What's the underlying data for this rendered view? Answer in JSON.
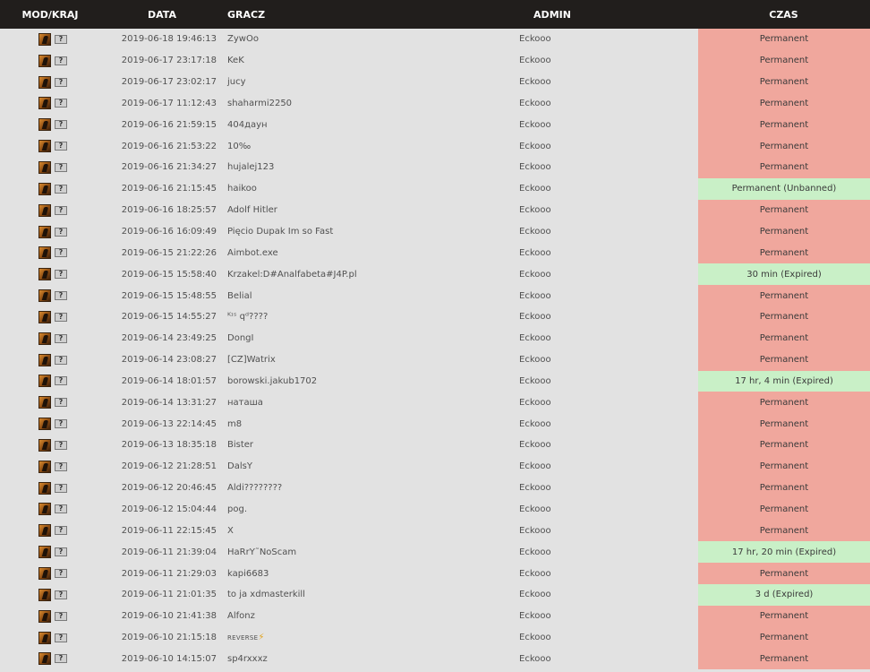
{
  "header": {
    "mod": "MOD/KRAJ",
    "date": "DATA",
    "player": "GRACZ",
    "admin": "ADMIN",
    "time": "CZAS"
  },
  "colors": {
    "permanent": "#f0a79d",
    "unbanned_or_expired": "#c9f0c7",
    "header_bg": "#211e1c",
    "row_bg": "#e2e2e2"
  },
  "icons": {
    "mod": "game-mod-icon",
    "country": "unknown-flag-icon",
    "country_glyph": "?"
  },
  "rows": [
    {
      "date": "2019-06-18 19:46:13",
      "player": "ZywOo",
      "admin": "Eckooo",
      "time": "Permanent",
      "status": "perm"
    },
    {
      "date": "2019-06-17 23:17:18",
      "player": "KeK",
      "admin": "Eckooo",
      "time": "Permanent",
      "status": "perm"
    },
    {
      "date": "2019-06-17 23:02:17",
      "player": "jucy",
      "admin": "Eckooo",
      "time": "Permanent",
      "status": "perm"
    },
    {
      "date": "2019-06-17 11:12:43",
      "player": "shaharmi2250",
      "admin": "Eckooo",
      "time": "Permanent",
      "status": "perm"
    },
    {
      "date": "2019-06-16 21:59:15",
      "player": "404даун",
      "admin": "Eckooo",
      "time": "Permanent",
      "status": "perm"
    },
    {
      "date": "2019-06-16 21:53:22",
      "player": "10‰",
      "admin": "Eckooo",
      "time": "Permanent",
      "status": "perm"
    },
    {
      "date": "2019-06-16 21:34:27",
      "player": "hujalej123",
      "admin": "Eckooo",
      "time": "Permanent",
      "status": "perm"
    },
    {
      "date": "2019-06-16 21:15:45",
      "player": "haikoo",
      "admin": "Eckooo",
      "time": "Permanent (Unbanned)",
      "status": "ok"
    },
    {
      "date": "2019-06-16 18:25:57",
      "player": "Adolf Hitler",
      "admin": "Eckooo",
      "time": "Permanent",
      "status": "perm"
    },
    {
      "date": "2019-06-16 16:09:49",
      "player": "Pięcio Dupak Im so Fast",
      "admin": "Eckooo",
      "time": "Permanent",
      "status": "perm"
    },
    {
      "date": "2019-06-15 21:22:26",
      "player": "Aimbot.exe",
      "admin": "Eckooo",
      "time": "Permanent",
      "status": "perm"
    },
    {
      "date": "2019-06-15 15:58:40",
      "player": "Krzakel:D#Analfabeta#J4P.pl",
      "admin": "Eckooo",
      "time": "30 min (Expired)",
      "status": "ok"
    },
    {
      "date": "2019-06-15 15:48:55",
      "player": "Belial",
      "admin": "Eckooo",
      "time": "Permanent",
      "status": "perm"
    },
    {
      "date": "2019-06-15 14:55:27",
      "player": "ᴷᶦˢ qᵈ????",
      "admin": "Eckooo",
      "time": "Permanent",
      "status": "perm"
    },
    {
      "date": "2019-06-14 23:49:25",
      "player": "DongI",
      "admin": "Eckooo",
      "time": "Permanent",
      "status": "perm"
    },
    {
      "date": "2019-06-14 23:08:27",
      "player": "[CZ]Watrix",
      "admin": "Eckooo",
      "time": "Permanent",
      "status": "perm"
    },
    {
      "date": "2019-06-14 18:01:57",
      "player": "borowski.jakub1702",
      "admin": "Eckooo",
      "time": "17 hr, 4 min (Expired)",
      "status": "ok"
    },
    {
      "date": "2019-06-14 13:31:27",
      "player": "наташа",
      "admin": "Eckooo",
      "time": "Permanent",
      "status": "perm"
    },
    {
      "date": "2019-06-13 22:14:45",
      "player": "m8",
      "admin": "Eckooo",
      "time": "Permanent",
      "status": "perm"
    },
    {
      "date": "2019-06-13 18:35:18",
      "player": "Bister",
      "admin": "Eckooo",
      "time": "Permanent",
      "status": "perm"
    },
    {
      "date": "2019-06-12 21:28:51",
      "player": "DalsY",
      "admin": "Eckooo",
      "time": "Permanent",
      "status": "perm"
    },
    {
      "date": "2019-06-12 20:46:45",
      "player": "Aldi????????",
      "admin": "Eckooo",
      "time": "Permanent",
      "status": "perm"
    },
    {
      "date": "2019-06-12 15:04:44",
      "player": "pog.",
      "admin": "Eckooo",
      "time": "Permanent",
      "status": "perm"
    },
    {
      "date": "2019-06-11 22:15:45",
      "player": "X",
      "admin": "Eckooo",
      "time": "Permanent",
      "status": "perm"
    },
    {
      "date": "2019-06-11 21:39:04",
      "player": "HaRrY˜NoScam",
      "admin": "Eckooo",
      "time": "17 hr, 20 min (Expired)",
      "status": "ok"
    },
    {
      "date": "2019-06-11 21:29:03",
      "player": "kapi6683",
      "admin": "Eckooo",
      "time": "Permanent",
      "status": "perm"
    },
    {
      "date": "2019-06-11 21:01:35",
      "player": "to ja xdmasterkill",
      "admin": "Eckooo",
      "time": "3 d (Expired)",
      "status": "ok"
    },
    {
      "date": "2019-06-10 21:41:38",
      "player": "Alfonz",
      "admin": "Eckooo",
      "time": "Permanent",
      "status": "perm"
    },
    {
      "date": "2019-06-10 21:15:18",
      "player": "REVERSE",
      "player_suffix": "⚡",
      "admin": "Eckooo",
      "time": "Permanent",
      "status": "perm"
    },
    {
      "date": "2019-06-10 14:15:07",
      "player": "sp4rxxxz",
      "admin": "Eckooo",
      "time": "Permanent",
      "status": "perm"
    }
  ]
}
